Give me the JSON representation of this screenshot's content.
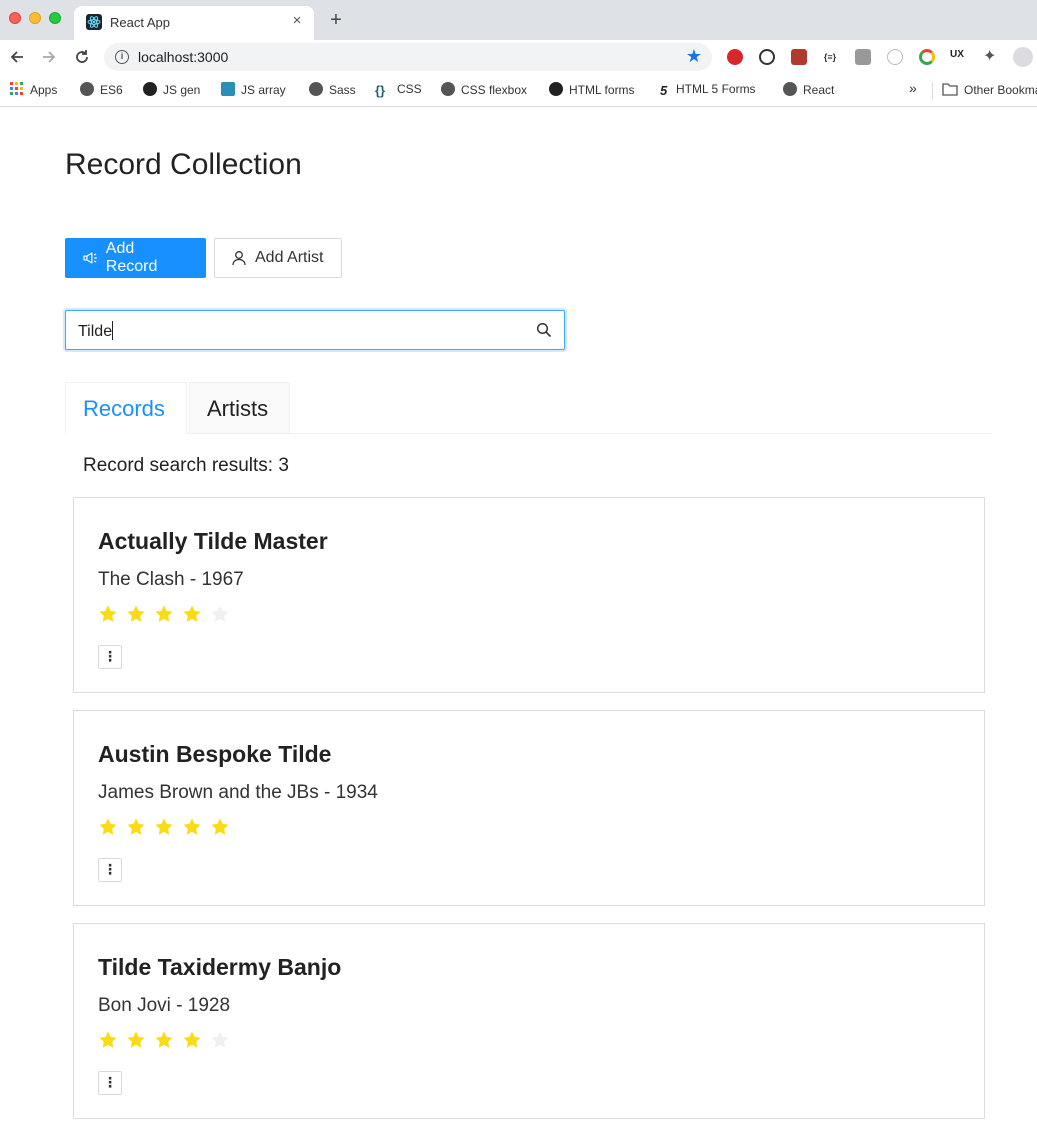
{
  "browser": {
    "tab_title": "React App",
    "tab_close": "×",
    "new_tab": "+",
    "url": "localhost:3000",
    "bookmarks": [
      {
        "label": "Apps"
      },
      {
        "label": "ES6"
      },
      {
        "label": "JS gen"
      },
      {
        "label": "JS array"
      },
      {
        "label": "Sass"
      },
      {
        "label": "CSS"
      },
      {
        "label": "CSS flexbox"
      },
      {
        "label": "HTML forms"
      },
      {
        "label": "HTML 5 Forms"
      },
      {
        "label": "React"
      }
    ],
    "bookmarks_overflow": "»",
    "other_bookmarks": "Other Bookmarks"
  },
  "page": {
    "title": "Record Collection",
    "add_record_label": "Add Record",
    "add_artist_label": "Add Artist",
    "search_value": "Tilde",
    "tabs": [
      {
        "label": "Records",
        "active": true
      },
      {
        "label": "Artists",
        "active": false
      }
    ],
    "results_text": "Record search results: 3"
  },
  "records": [
    {
      "title": "Actually Tilde Master",
      "subtitle": "The Clash - 1967",
      "rating": 4,
      "max_rating": 5
    },
    {
      "title": "Austin Bespoke Tilde",
      "subtitle": "James Brown and the JBs - 1934",
      "rating": 5,
      "max_rating": 5
    },
    {
      "title": "Tilde Taxidermy Banjo",
      "subtitle": "Bon Jovi - 1928",
      "rating": 4,
      "max_rating": 5
    }
  ],
  "menu_glyph": "⋮",
  "colors": {
    "primary": "#1890ff",
    "star_filled": "#fadb14",
    "star_empty": "#f0f0f0"
  }
}
